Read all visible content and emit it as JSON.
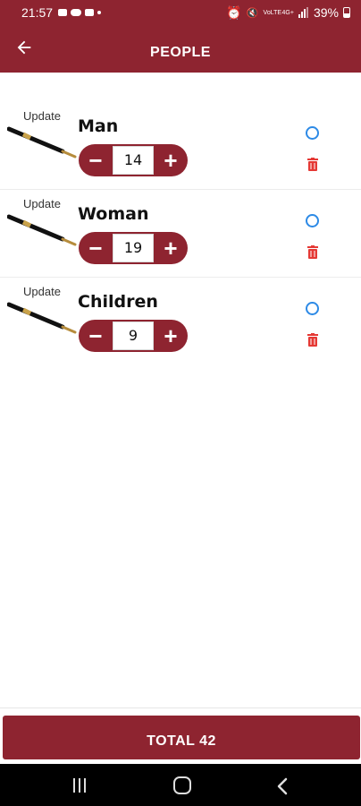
{
  "status_bar": {
    "time": "21:57",
    "battery": "39%",
    "network_label": "VoLTE"
  },
  "header": {
    "title": "PEOPLE"
  },
  "items": [
    {
      "update_label": "Update",
      "name": "Man",
      "quantity": "14"
    },
    {
      "update_label": "Update",
      "name": "Woman",
      "quantity": "19"
    },
    {
      "update_label": "Update",
      "name": "Children",
      "quantity": "9"
    }
  ],
  "icons": {
    "back": "arrow-left-icon",
    "decrement": "minus-icon",
    "increment": "plus-icon",
    "select": "radio-circle-icon",
    "delete": "trash-icon",
    "item_image": "pen-icon"
  },
  "colors": {
    "primary": "#8e2430",
    "radio": "#2d8ae6",
    "trash": "#e53935"
  },
  "footer": {
    "total_label": "TOTAL 42"
  }
}
